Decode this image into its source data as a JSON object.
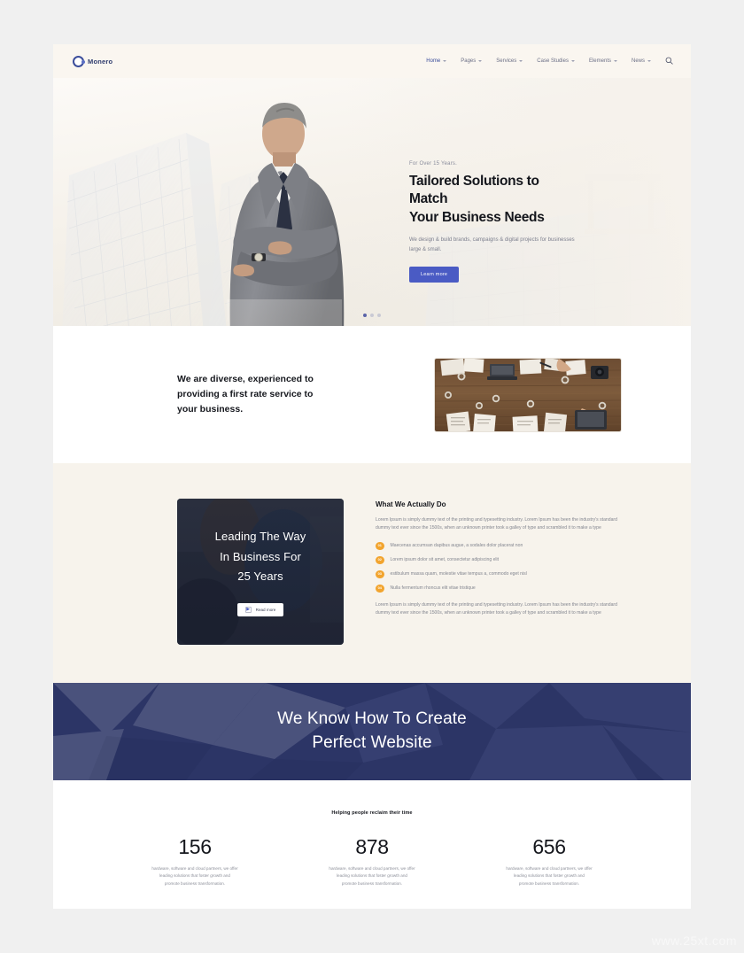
{
  "brand": {
    "name": "Monero",
    "logo_icon": "circle-logo-icon"
  },
  "nav": {
    "items": [
      {
        "label": "Home",
        "has_dropdown": true,
        "active": true
      },
      {
        "label": "Pages",
        "has_dropdown": true,
        "active": false
      },
      {
        "label": "Services",
        "has_dropdown": true,
        "active": false
      },
      {
        "label": "Case Studies",
        "has_dropdown": true,
        "active": false
      },
      {
        "label": "Elements",
        "has_dropdown": true,
        "active": false
      },
      {
        "label": "News",
        "has_dropdown": true,
        "active": false
      }
    ],
    "search_icon": "search-icon"
  },
  "hero": {
    "eyebrow": "For Over 15 Years.",
    "title_line1": "Tailored Solutions to Match",
    "title_line2": "Your Business Needs",
    "subtitle": "We design & build brands, campaigns & digital projects for businesses large & small.",
    "cta_label": "Learn more",
    "slide_count": 3,
    "active_slide": 1
  },
  "diverse": {
    "heading": "We are diverse, experienced to providing a first rate service to your business.",
    "image_alt": "desk-workspace-photo"
  },
  "what_we_do": {
    "card_title_line1": "Leading The Way",
    "card_title_line2": "In Business For",
    "card_title_line3": "25 Years",
    "card_cta_label": "Read more",
    "heading": "What We Actually Do",
    "paragraph_top": "Lorem Ipsum is simply dummy text of the printing and typesetting industry. Lorem Ipsum has been the industry's standard dummy text ever since the 1500s, when an unknown printer took a galley of type and scrambled it to make a type",
    "list": [
      {
        "num": "01",
        "text": "Maecenas accumsan dapibus augue, a sodales dolor placerat non"
      },
      {
        "num": "02",
        "text": "Lorem ipsum dolor sit amet, consectetur adipiscing elit"
      },
      {
        "num": "03",
        "text": "estibulum massa quam, molestie vitae tempus a, commodo eget nisl"
      },
      {
        "num": "04",
        "text": "Nulla fermentum rhoncus elit vitae tristique"
      }
    ],
    "paragraph_bottom": "Lorem Ipsum is simply dummy text of the printing and typesetting industry. Lorem Ipsum has been the industry's standard dummy text ever since the 1500s, when an unknown printer took a galley of type and scrambled it to make a type"
  },
  "banner": {
    "line1": "We Know How To Create",
    "line2": "Perfect Website",
    "bg_color": "#2c3566"
  },
  "stats": {
    "heading": "Helping people reclaim their time",
    "items": [
      {
        "value": "156",
        "description": "hardware, software and cloud partners, we offer leading solutions that foster growth and promote business transformation."
      },
      {
        "value": "878",
        "description": "hardware, software and cloud partners, we offer leading solutions that foster growth and promote business transformation."
      },
      {
        "value": "656",
        "description": "hardware, software and cloud partners, we offer leading solutions that foster growth and promote business transformation."
      }
    ]
  },
  "watermark": {
    "text": "www.25xt.com"
  },
  "colors": {
    "accent_blue": "#4a5bc4",
    "deep_navy": "#2c3566",
    "beige": "#f7f3ec",
    "orange": "#f2a42e"
  }
}
